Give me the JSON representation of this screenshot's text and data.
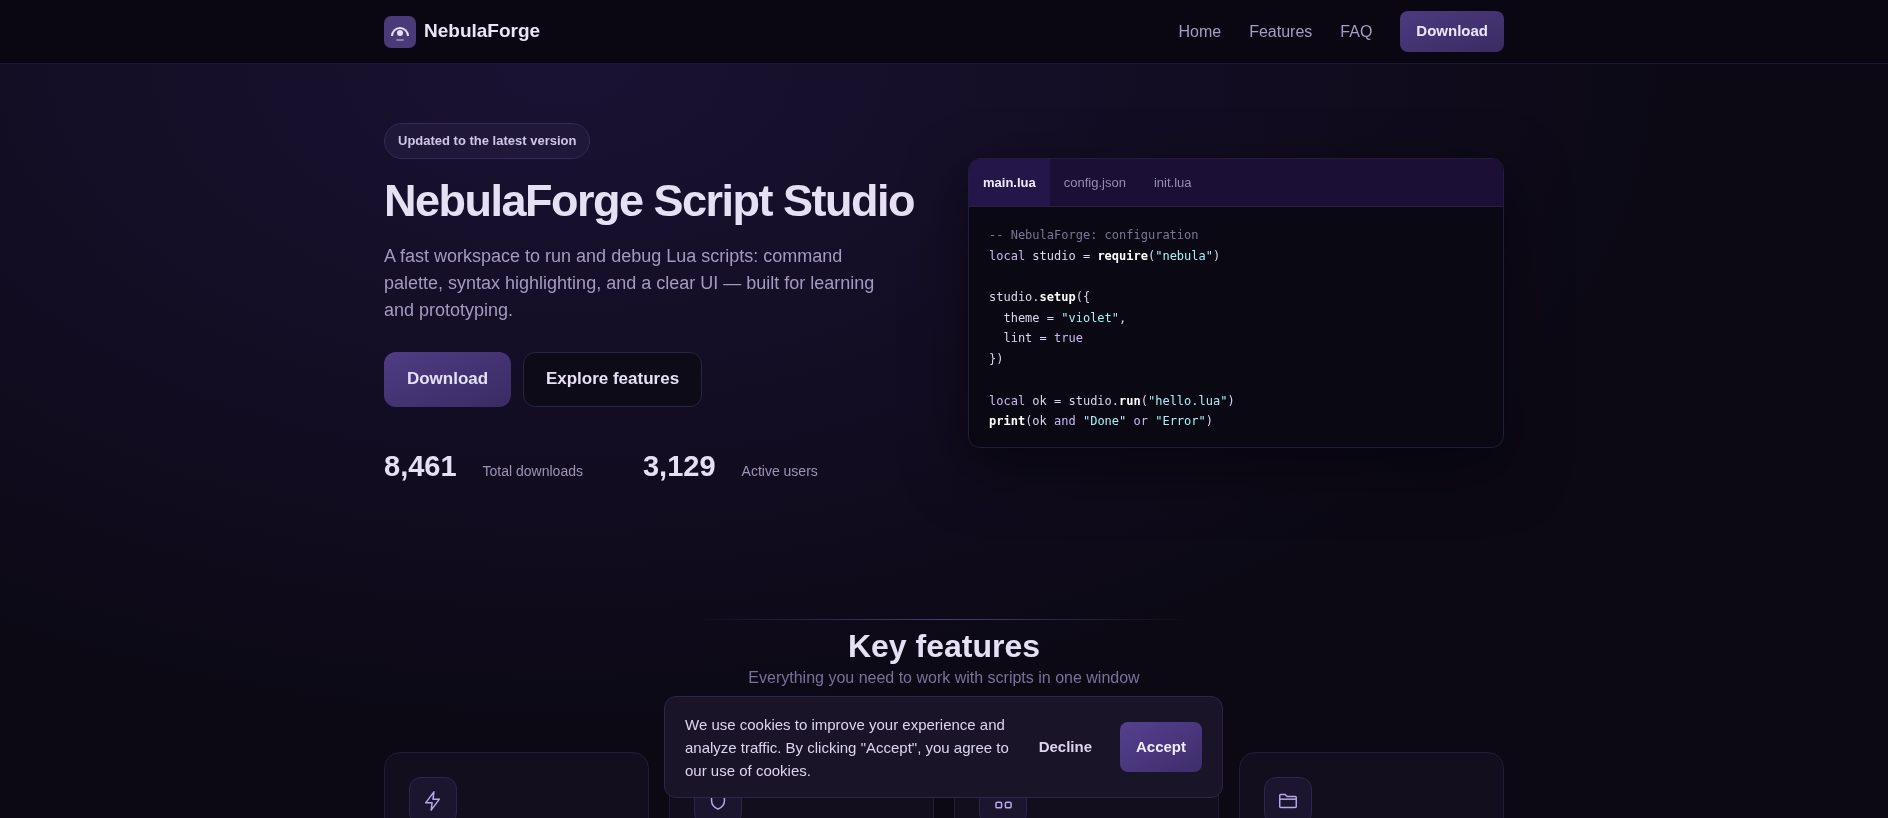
{
  "header": {
    "brand": "NebulaForge",
    "nav": [
      {
        "label": "Home",
        "kind": "link"
      },
      {
        "label": "Features",
        "kind": "link"
      },
      {
        "label": "FAQ",
        "kind": "link"
      },
      {
        "label": "Download",
        "kind": "button"
      }
    ]
  },
  "hero": {
    "badge": "Updated to the latest version",
    "title": "NebulaForge Script Studio",
    "description": "A fast workspace to run and debug Lua scripts: command palette, syntax highlighting, and a clear UI — built for learning and prototyping.",
    "buttons": [
      {
        "label": "Download",
        "kind": "primary"
      },
      {
        "label": "Explore features",
        "kind": "secondary"
      }
    ],
    "stats": [
      {
        "value": "8,461",
        "label": "Total downloads"
      },
      {
        "value": "3,129",
        "label": "Active users"
      }
    ]
  },
  "editor": {
    "tabs": [
      {
        "label": "main.lua",
        "selected": true
      },
      {
        "label": "config.json",
        "selected": false
      },
      {
        "label": "init.lua",
        "selected": false
      }
    ],
    "lines": [
      {
        "kind": "code",
        "tokens": [
          {
            "kind": "comment",
            "text": "-- NebulaForge: configuration"
          }
        ]
      },
      {
        "kind": "code",
        "tokens": [
          {
            "kind": "keyword",
            "text": "local"
          },
          {
            "kind": "plain",
            "text": " studio = "
          },
          {
            "kind": "function",
            "text": "require"
          },
          {
            "kind": "plain",
            "text": "("
          },
          {
            "kind": "string",
            "text": "\"nebula\""
          },
          {
            "kind": "plain",
            "text": ")"
          }
        ]
      },
      {
        "kind": "blank"
      },
      {
        "kind": "code",
        "tokens": [
          {
            "kind": "plain",
            "text": "studio."
          },
          {
            "kind": "function",
            "text": "setup"
          },
          {
            "kind": "plain",
            "text": "({"
          }
        ]
      },
      {
        "kind": "code",
        "tokens": [
          {
            "kind": "plain",
            "text": "  theme = "
          },
          {
            "kind": "string",
            "text": "\"violet\""
          },
          {
            "kind": "plain",
            "text": ","
          }
        ]
      },
      {
        "kind": "code",
        "tokens": [
          {
            "kind": "plain",
            "text": "  lint = "
          },
          {
            "kind": "keyword",
            "text": "true"
          }
        ]
      },
      {
        "kind": "code",
        "tokens": [
          {
            "kind": "plain",
            "text": "})"
          }
        ]
      },
      {
        "kind": "blank"
      },
      {
        "kind": "code",
        "tokens": [
          {
            "kind": "keyword",
            "text": "local"
          },
          {
            "kind": "plain",
            "text": " ok = studio."
          },
          {
            "kind": "function",
            "text": "run"
          },
          {
            "kind": "plain",
            "text": "("
          },
          {
            "kind": "string",
            "text": "\"hello.lua\""
          },
          {
            "kind": "plain",
            "text": ")"
          }
        ]
      },
      {
        "kind": "code",
        "tokens": [
          {
            "kind": "function",
            "text": "print"
          },
          {
            "kind": "plain",
            "text": "(ok "
          },
          {
            "kind": "keyword",
            "text": "and"
          },
          {
            "kind": "string",
            "text": " \"Done\" "
          },
          {
            "kind": "keyword",
            "text": "or"
          },
          {
            "kind": "string",
            "text": " \"Error\""
          },
          {
            "kind": "plain",
            "text": ")"
          }
        ]
      }
    ]
  },
  "features": {
    "title": "Key features",
    "subtitle": "Everything you need to work with scripts in one window"
  },
  "cookie_banner": {
    "text": "We use cookies to improve your experience and analyze traffic. By clicking \"Accept\", you agree to our use of cookies.",
    "buttons": [
      {
        "label": "Decline",
        "kind": "secondary"
      },
      {
        "label": "Accept",
        "kind": "primary"
      }
    ]
  }
}
